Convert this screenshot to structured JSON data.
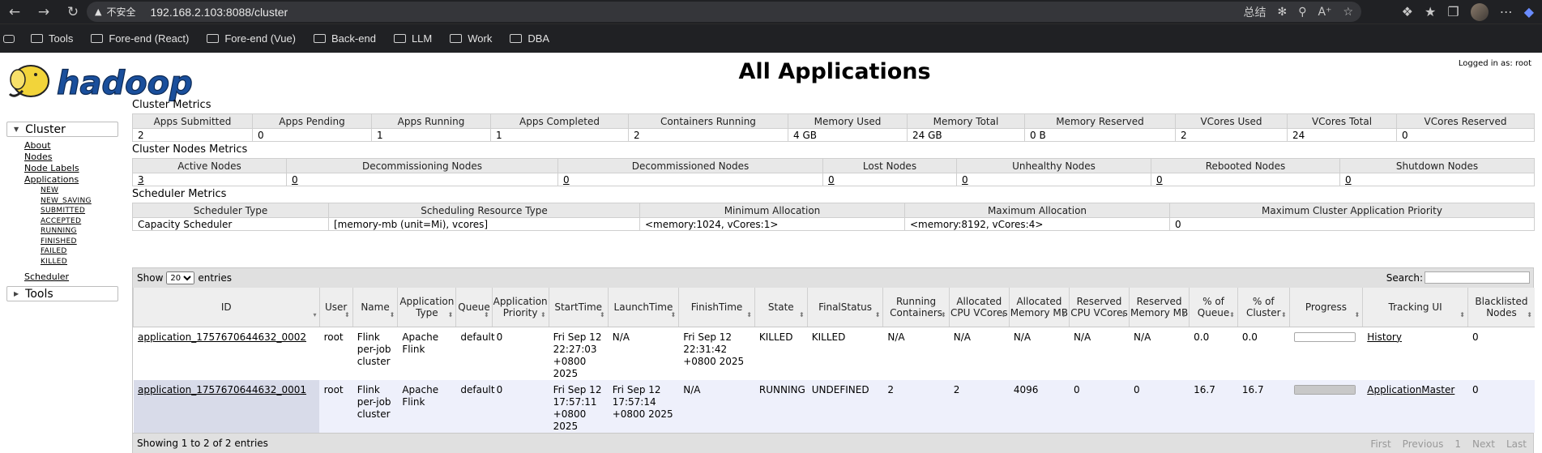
{
  "browser": {
    "security_label": "不安全",
    "url": "192.168.2.103:8088/cluster",
    "summary_label": "总结",
    "bookmarks": [
      "Tools",
      "Fore-end  (React)",
      "Fore-end  (Vue)",
      "Back-end",
      "LLM",
      "Work",
      "DBA"
    ]
  },
  "header": {
    "logo_text": "hadoop",
    "title": "All Applications",
    "logged_in": "Logged in as: root"
  },
  "sidebar": {
    "cluster_label": "Cluster",
    "cluster_links": [
      "About",
      "Nodes",
      "Node Labels",
      "Applications"
    ],
    "app_states": [
      "NEW",
      "NEW_SAVING",
      "SUBMITTED",
      "ACCEPTED",
      "RUNNING",
      "FINISHED",
      "FAILED",
      "KILLED"
    ],
    "scheduler_label": "Scheduler",
    "tools_label": "Tools"
  },
  "cluster_metrics": {
    "title": "Cluster Metrics",
    "headers": [
      "Apps Submitted",
      "Apps Pending",
      "Apps Running",
      "Apps Completed",
      "Containers Running",
      "Memory Used",
      "Memory Total",
      "Memory Reserved",
      "VCores Used",
      "VCores Total",
      "VCores Reserved"
    ],
    "values": [
      "2",
      "0",
      "1",
      "1",
      "2",
      "4 GB",
      "24 GB",
      "0 B",
      "2",
      "24",
      "0"
    ]
  },
  "node_metrics": {
    "title": "Cluster Nodes Metrics",
    "headers": [
      "Active Nodes",
      "Decommissioning Nodes",
      "Decommissioned Nodes",
      "Lost Nodes",
      "Unhealthy Nodes",
      "Rebooted Nodes",
      "Shutdown Nodes"
    ],
    "values": [
      "3",
      "0",
      "0",
      "0",
      "0",
      "0",
      "0"
    ]
  },
  "scheduler_metrics": {
    "title": "Scheduler Metrics",
    "headers": [
      "Scheduler Type",
      "Scheduling Resource Type",
      "Minimum Allocation",
      "Maximum Allocation",
      "Maximum Cluster Application Priority"
    ],
    "values": [
      "Capacity Scheduler",
      "[memory-mb (unit=Mi), vcores]",
      "<memory:1024, vCores:1>",
      "<memory:8192, vCores:4>",
      "0"
    ]
  },
  "apps_table": {
    "show_label": "Show",
    "entries_value": "20",
    "entries_label": "entries",
    "search_label": "Search:",
    "columns": [
      "ID",
      "User",
      "Name",
      "Application Type",
      "Queue",
      "Application Priority",
      "StartTime",
      "LaunchTime",
      "FinishTime",
      "State",
      "FinalStatus",
      "Running Containers",
      "Allocated CPU VCores",
      "Allocated Memory MB",
      "Reserved CPU VCores",
      "Reserved Memory MB",
      "% of Queue",
      "% of Cluster",
      "Progress",
      "Tracking UI",
      "Blacklisted Nodes"
    ],
    "rows": [
      {
        "id": "application_1757670644632_0002",
        "user": "root",
        "name": "Flink per-job cluster",
        "type": "Apache Flink",
        "queue": "default",
        "priority": "0",
        "start": "Fri Sep 12 22:27:03 +0800 2025",
        "launch": "N/A",
        "finish": "Fri Sep 12 22:31:42 +0800 2025",
        "state": "KILLED",
        "final_status": "KILLED",
        "running_containers": "N/A",
        "alloc_vcores": "N/A",
        "alloc_mem": "N/A",
        "res_vcores": "N/A",
        "res_mem": "N/A",
        "pct_queue": "0.0",
        "pct_cluster": "0.0",
        "progress": 0,
        "tracking": "History",
        "blacklisted": "0"
      },
      {
        "id": "application_1757670644632_0001",
        "user": "root",
        "name": "Flink per-job cluster",
        "type": "Apache Flink",
        "queue": "default",
        "priority": "0",
        "start": "Fri Sep 12 17:57:11 +0800 2025",
        "launch": "Fri Sep 12 17:57:14 +0800 2025",
        "finish": "N/A",
        "state": "RUNNING",
        "final_status": "UNDEFINED",
        "running_containers": "2",
        "alloc_vcores": "2",
        "alloc_mem": "4096",
        "res_vcores": "0",
        "res_mem": "0",
        "pct_queue": "16.7",
        "pct_cluster": "16.7",
        "progress": 100,
        "tracking": "ApplicationMaster",
        "blacklisted": "0"
      }
    ],
    "footer": "Showing 1 to 2 of 2 entries",
    "pager": [
      "First",
      "Previous",
      "1",
      "Next",
      "Last"
    ]
  }
}
